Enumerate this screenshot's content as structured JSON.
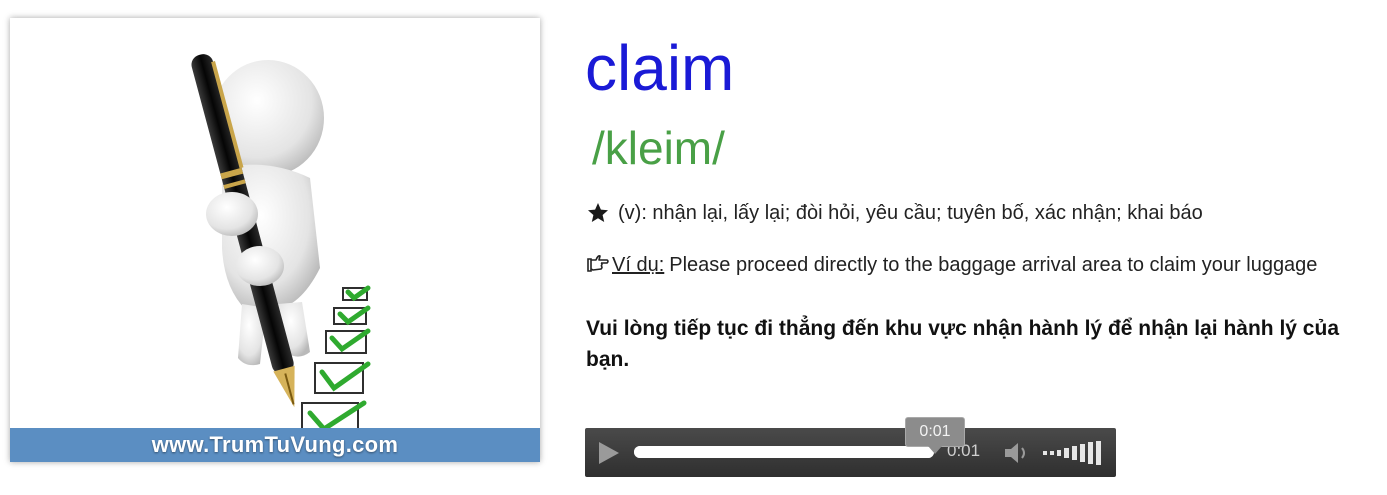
{
  "illustration": {
    "icon": "3d-person-pen-checklist-icon",
    "watermark": "www.TrumTuVung.com",
    "banner_color": "#5b8ec2"
  },
  "entry": {
    "word": "claim",
    "phonetic": "/kleim/",
    "definition_icon": "star-icon",
    "definition": "(v): nhận lại, lấy lại; đòi hỏi, yêu cầu; tuyên bố, xác nhận; khai báo",
    "example_icon": "pointing-hand-icon",
    "example_label": "Ví dụ:",
    "example_text": "Please proceed directly to the baggage arrival area to claim your luggage",
    "translation": "Vui lòng tiếp tục đi thẳng đến khu vực nhận hành lý để nhận lại hành lý của bạn."
  },
  "colors": {
    "word": "#1a1ad6",
    "phonetic": "#49a046"
  },
  "audio": {
    "play_icon": "play-icon",
    "time": "0:01",
    "tooltip": "0:01",
    "progress": 1.0,
    "volume_icon": "volume-icon",
    "volume_level_icon": "volume-bars-icon"
  }
}
